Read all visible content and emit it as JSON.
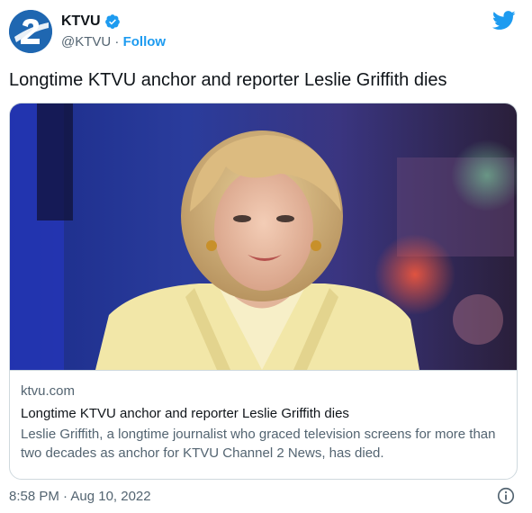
{
  "author": {
    "name": "KTVU",
    "handle": "@KTVU",
    "separator": " · ",
    "follow_label": "Follow",
    "verified": true,
    "avatar_icon": "ktvu-channel-2-logo"
  },
  "tweet": {
    "text": "Longtime KTVU anchor and reporter Leslie Griffith dies",
    "timestamp": "8:58 PM · Aug 10, 2022"
  },
  "card": {
    "image_alt": "news-anchor-photo",
    "domain": "ktvu.com",
    "title": "Longtime KTVU anchor and reporter Leslie Griffith dies",
    "description": "Leslie Griffith, a longtime journalist who graced television screens for more than two decades as anchor for KTVU Channel 2 News, has died."
  },
  "icons": {
    "brand": "twitter-bird-icon",
    "info": "info-icon",
    "verified": "verified-badge-icon"
  },
  "colors": {
    "accent": "#1d9bf0",
    "avatar_bg": "#1f67b1",
    "text_primary": "#0f1419",
    "text_secondary": "#536471",
    "border": "#cfd9de"
  }
}
